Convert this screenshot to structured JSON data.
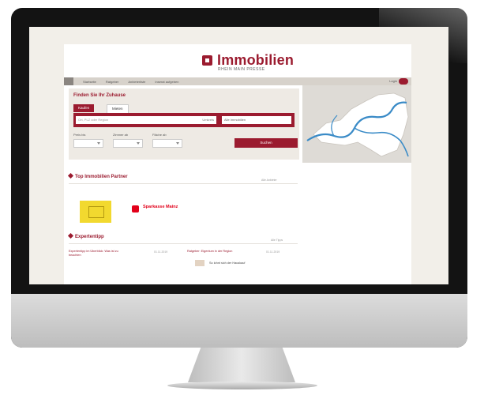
{
  "brand": {
    "name": "Immobilien",
    "tagline": "RHEIN MAIN PRESSE",
    "color": "#9b1b2f"
  },
  "nav": {
    "items": [
      "Startseite",
      "Ratgeber",
      "Anbieterliste",
      "Inserat aufgeben"
    ],
    "login": "Login"
  },
  "search": {
    "title": "Finden Sie Ihr Zuhause",
    "tabs": [
      {
        "label": "Kaufen",
        "active": true
      },
      {
        "label": "Mieten",
        "active": false
      }
    ],
    "location_placeholder": "Ort, PLZ oder Region",
    "radius": "Umkreis",
    "type_value": "Alle Immobilien",
    "filters": [
      {
        "label": "Preis bis"
      },
      {
        "label": "Zimmer ab"
      },
      {
        "label": "Fläche ab"
      }
    ],
    "button_label": "Suchen"
  },
  "partners": {
    "title": "Top Immobilien Partner",
    "more": "Alle Anbieter",
    "items": [
      "Sparkasse Mainz"
    ]
  },
  "tips": {
    "title": "Expertentipp",
    "more": "Alle Tipps",
    "items": [
      {
        "title": "Expertentipp im Überblick: Was ist zu beachten",
        "date": "01.11.2019"
      },
      {
        "title": "Ratgeber: Eigentum in der Region",
        "date": "01.11.2019",
        "text": "So lohnt sich der Hauskauf"
      }
    ]
  },
  "map": {
    "label": "Karte",
    "river_color": "#3a8bc7"
  }
}
